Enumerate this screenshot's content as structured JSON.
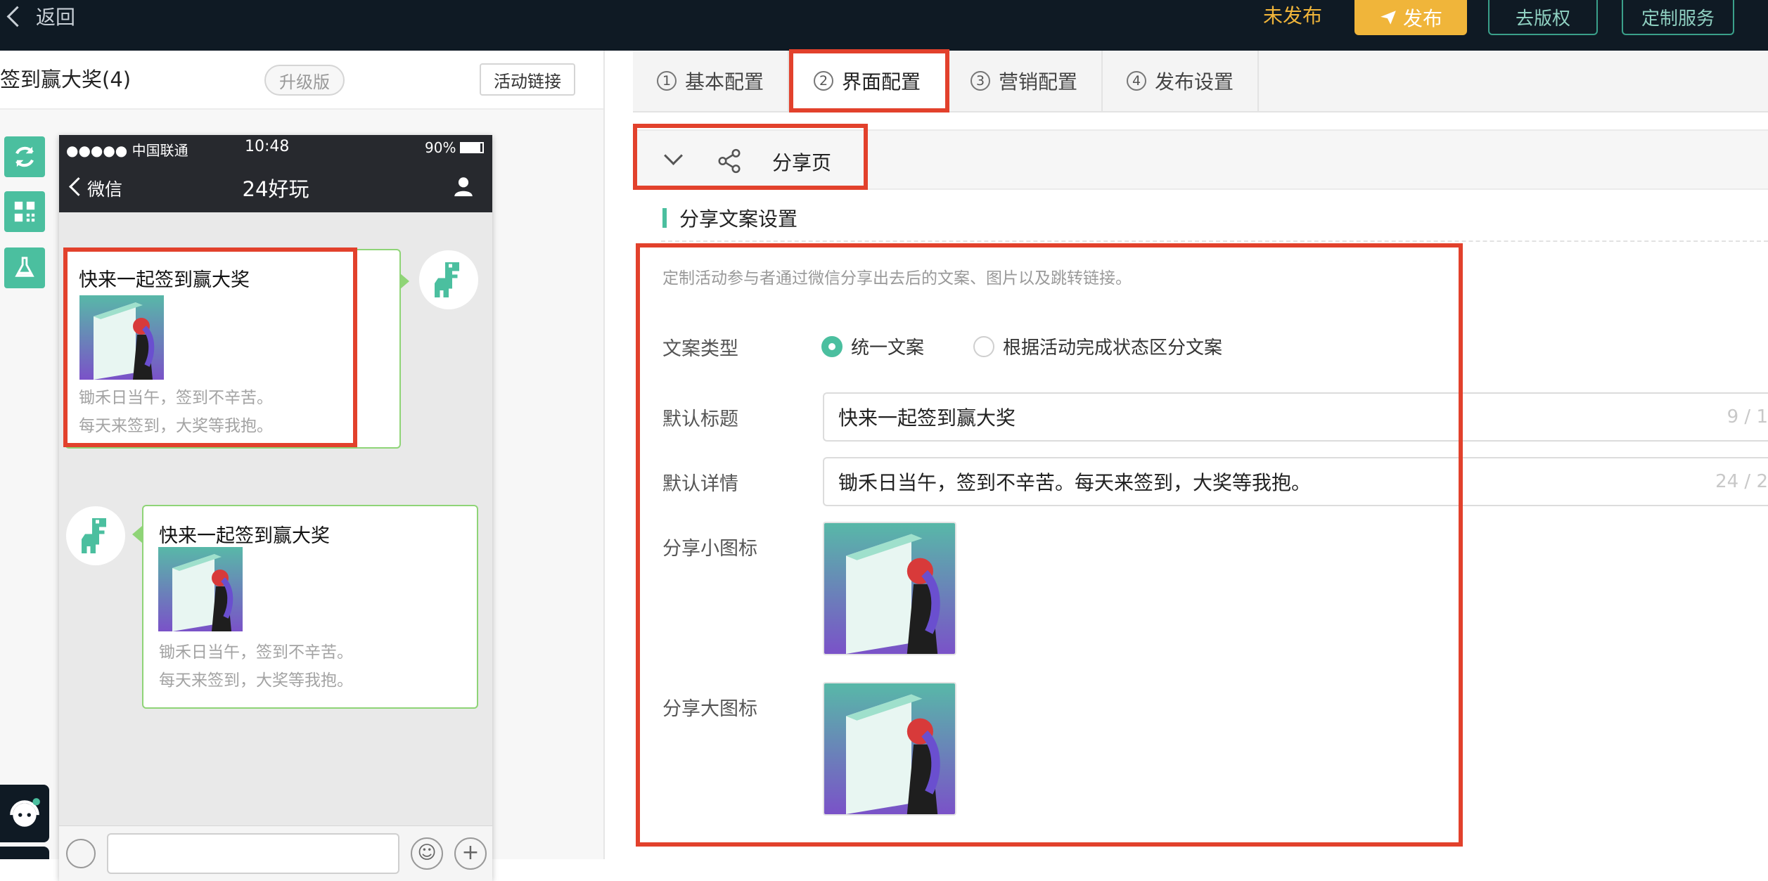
{
  "topbar": {
    "back_label": "返回",
    "status_label": "未发布",
    "publish_label": "发布",
    "copyright_label": "去版权",
    "custom_label": "定制服务"
  },
  "left": {
    "title": "签到赢大奖(4)",
    "badge": "升级版",
    "link_button": "活动链接",
    "phone": {
      "carrier": "●●●●● 中国联通",
      "time": "10:48",
      "battery": "90%",
      "back_label": "微信",
      "chat_title": "24好玩"
    },
    "bubble1": {
      "title": "快来一起签到赢大奖",
      "line1": "锄禾日当午，签到不辛苦。",
      "line2": "每天来签到，大奖等我抱。"
    },
    "bubble2": {
      "title": "快来一起签到赢大奖",
      "line1": "锄禾日当午，签到不辛苦。",
      "line2": "每天来签到，大奖等我抱。"
    }
  },
  "tabs": [
    {
      "num": "1",
      "label": "基本配置"
    },
    {
      "num": "2",
      "label": "界面配置"
    },
    {
      "num": "3",
      "label": "营销配置"
    },
    {
      "num": "4",
      "label": "发布设置"
    }
  ],
  "accordion": {
    "title": "分享页"
  },
  "section": {
    "title": "分享文案设置",
    "description": "定制活动参与者通过微信分享出去后的文案、图片以及跳转链接。"
  },
  "form": {
    "type_label": "文案类型",
    "radio1": "统一文案",
    "radio2": "根据活动完成状态区分文案",
    "title_label": "默认标题",
    "title_value": "快来一起签到赢大奖",
    "title_count": "9 / 1",
    "detail_label": "默认详情",
    "detail_value": "锄禾日当午，签到不辛苦。每天来签到，大奖等我抱。",
    "detail_count": "24 / 2",
    "small_icon_label": "分享小图标",
    "big_icon_label": "分享大图标"
  },
  "colors": {
    "accent": "#4bbf9f",
    "topbar": "#0f1a24",
    "publish": "#f0b53a",
    "highlight": "#e2412c"
  }
}
